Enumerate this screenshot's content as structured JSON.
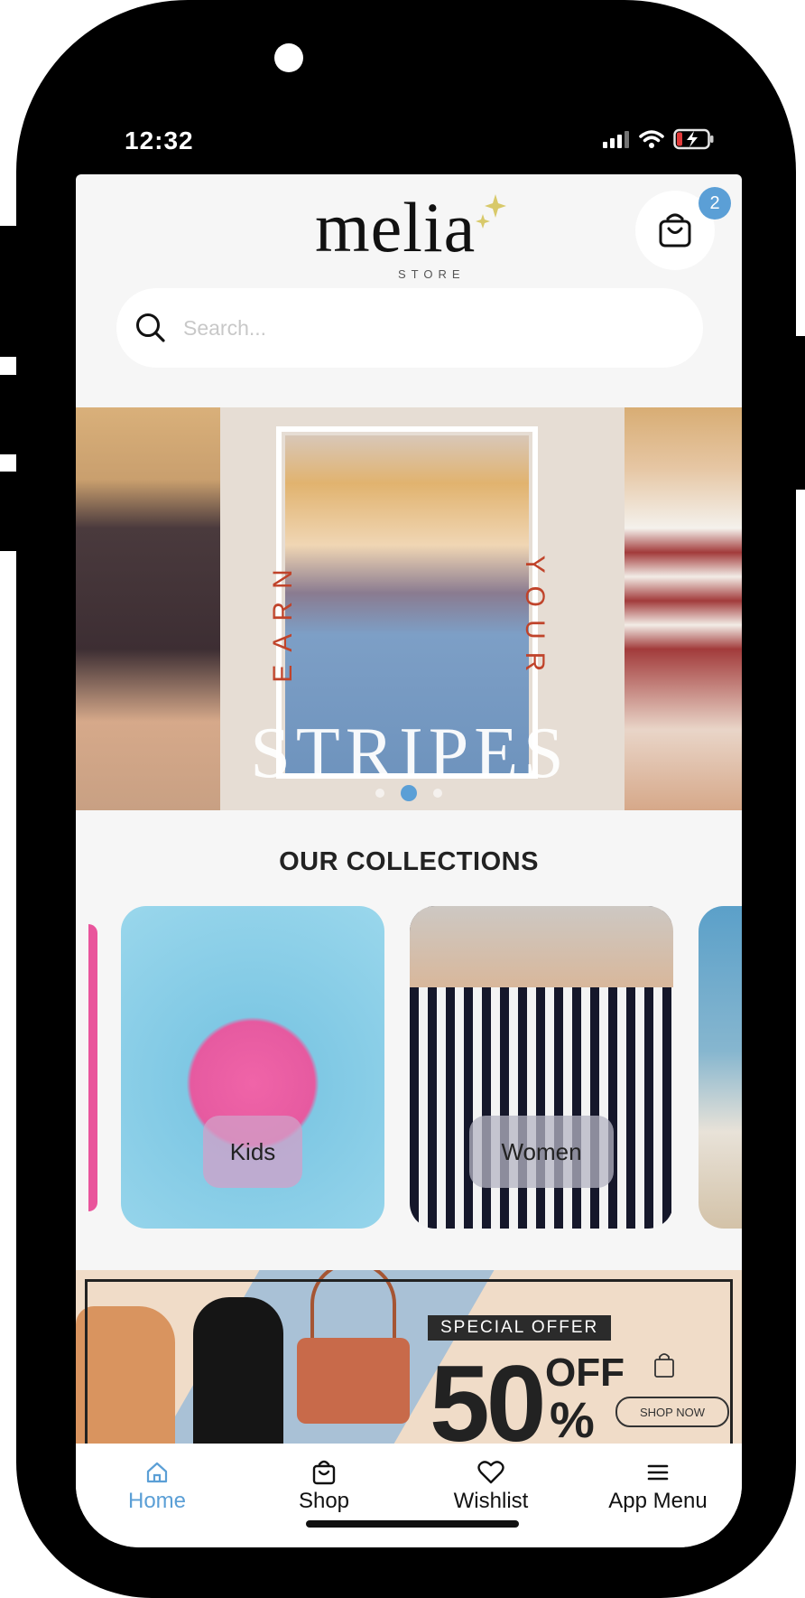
{
  "status_bar": {
    "time": "12:32"
  },
  "header": {
    "logo_text": "melia",
    "logo_subtext": "STORE",
    "cart_count": "2"
  },
  "search": {
    "placeholder": "Search..."
  },
  "hero": {
    "text_left": "EARN",
    "text_right": "YOUR",
    "text_main": "STRIPES",
    "slides_count": 3,
    "active_slide": 2
  },
  "collections": {
    "title": "OUR COLLECTIONS",
    "items": [
      {
        "label": "Kids"
      },
      {
        "label": "Women"
      }
    ]
  },
  "promo": {
    "badge": "SPECIAL OFFER",
    "discount": "50",
    "off": "OFF",
    "percent": "%",
    "cta": "SHOP NOW"
  },
  "bottom_nav": {
    "items": [
      {
        "label": "Home",
        "icon": "home-icon",
        "active": true
      },
      {
        "label": "Shop",
        "icon": "shopping-bag-icon",
        "active": false
      },
      {
        "label": "Wishlist",
        "icon": "heart-icon",
        "active": false
      },
      {
        "label": "App Menu",
        "icon": "menu-icon",
        "active": false
      }
    ]
  },
  "colors": {
    "accent": "#5b9fd6",
    "background": "#f6f6f6",
    "hero_text": "#c0432a"
  }
}
